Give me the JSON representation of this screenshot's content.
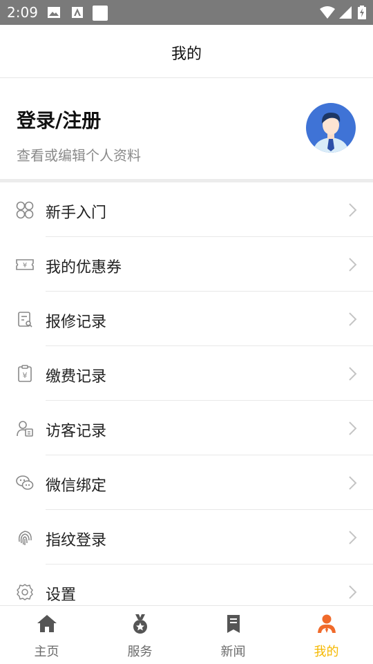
{
  "status_bar": {
    "time": "2:09"
  },
  "header": {
    "title": "我的"
  },
  "profile": {
    "login_label": "登录/注册",
    "subtitle": "查看或编辑个人资料"
  },
  "menu": {
    "items": [
      {
        "label": "新手入门",
        "icon": "grid-icon"
      },
      {
        "label": "我的优惠券",
        "icon": "coupon-icon"
      },
      {
        "label": "报修记录",
        "icon": "repair-icon"
      },
      {
        "label": "缴费记录",
        "icon": "payment-icon"
      },
      {
        "label": "访客记录",
        "icon": "visitor-icon"
      },
      {
        "label": "微信绑定",
        "icon": "wechat-icon"
      },
      {
        "label": "指纹登录",
        "icon": "fingerprint-icon"
      },
      {
        "label": "设置",
        "icon": "gear-icon"
      }
    ]
  },
  "tabbar": {
    "tabs": [
      {
        "label": "主页",
        "icon": "home-icon"
      },
      {
        "label": "服务",
        "icon": "medal-icon"
      },
      {
        "label": "新闻",
        "icon": "bookmark-icon"
      },
      {
        "label": "我的",
        "icon": "person-icon",
        "active": true
      }
    ]
  },
  "colors": {
    "accent": "#f5b800",
    "active_icon": "#f06a2a",
    "avatar_bg": "#3f73d6"
  }
}
